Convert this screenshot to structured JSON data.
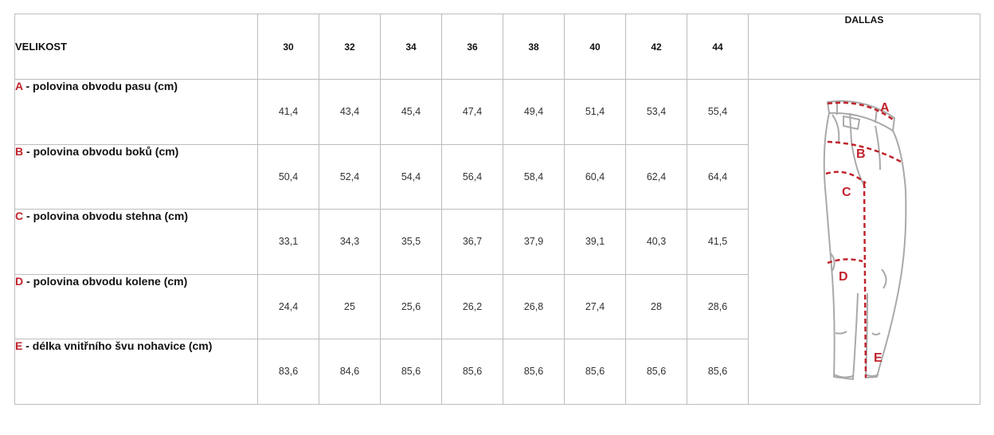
{
  "header": {
    "label": "VELIKOST",
    "sizes": [
      "30",
      "32",
      "34",
      "36",
      "38",
      "40",
      "42",
      "44"
    ],
    "model": "DALLAS"
  },
  "rows": [
    {
      "letter": "A",
      "label": " - polovina obvodu pasu  (cm)",
      "values": [
        "41,4",
        "43,4",
        "45,4",
        "47,4",
        "49,4",
        "51,4",
        "53,4",
        "55,4"
      ]
    },
    {
      "letter": "B",
      "label": " - polovina obvodu boků  (cm)",
      "values": [
        "50,4",
        "52,4",
        "54,4",
        "56,4",
        "58,4",
        "60,4",
        "62,4",
        "64,4"
      ]
    },
    {
      "letter": "C",
      "label": " - polovina obvodu stehna  (cm)",
      "values": [
        "33,1",
        "34,3",
        "35,5",
        "36,7",
        "37,9",
        "39,1",
        "40,3",
        "41,5"
      ]
    },
    {
      "letter": "D",
      "label": " - polovina obvodu kolene  (cm)",
      "values": [
        "24,4",
        "25",
        "25,6",
        "26,2",
        "26,8",
        "27,4",
        "28",
        "28,6"
      ]
    },
    {
      "letter": "E",
      "label": " - délka vnitřního švu nohavice  (cm)",
      "values": [
        "83,6",
        "84,6",
        "85,6",
        "85,6",
        "85,6",
        "85,6",
        "85,6",
        "85,6"
      ]
    }
  ],
  "illustration": {
    "icon": "jeans-measurement-icon",
    "markers": [
      "A",
      "B",
      "C",
      "D",
      "E"
    ],
    "accent_color": "#c0232c"
  }
}
